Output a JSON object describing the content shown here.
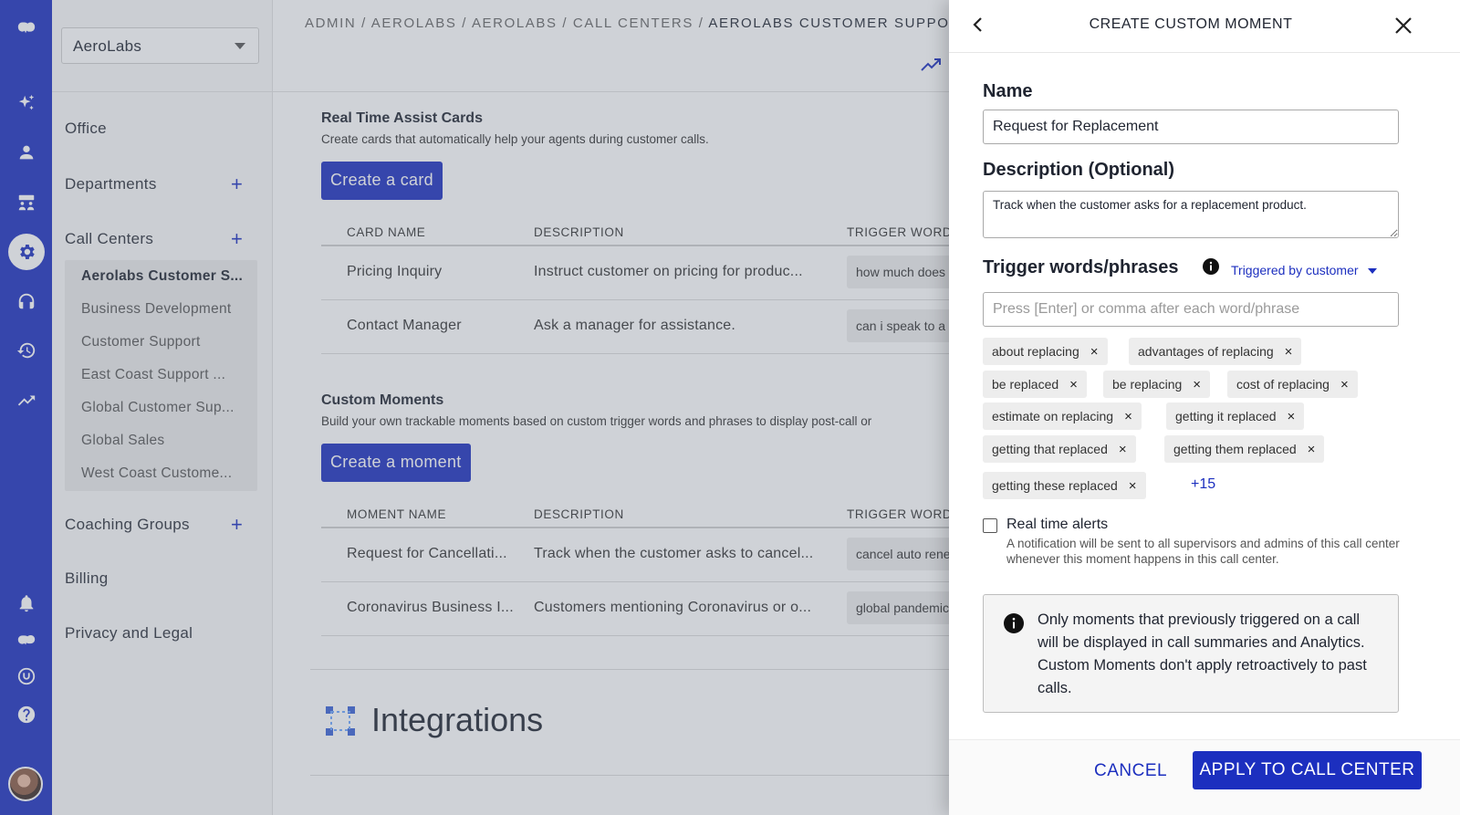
{
  "sidebar": {
    "icons": [
      "dialpad-logo-icon",
      "sparkle-icon",
      "user-icon",
      "contact-center-icon",
      "gear-icon",
      "headset-icon",
      "history-icon",
      "trend-icon",
      "bell-icon",
      "dialpad-icon",
      "chat-icon",
      "help-icon",
      "avatar"
    ],
    "org_select": "AeroLabs",
    "items": {
      "office": "Office",
      "departments": "Departments",
      "call_centers": "Call Centers",
      "coaching_groups": "Coaching Groups",
      "billing": "Billing",
      "privacy": "Privacy and Legal"
    },
    "call_centers": [
      "Aerolabs Customer S...",
      "Business Development",
      "Customer Support",
      "East Coast Support ...",
      "Global Customer Sup...",
      "Global Sales",
      "West Coast Custome..."
    ],
    "plus": "+"
  },
  "breadcrumb": {
    "path": "ADMIN / AEROLABS / AEROLABS / CALL CENTERS / ",
    "current": "AEROLABS CUSTOMER SUPPORT"
  },
  "cards": {
    "title": "Real Time Assist Cards",
    "subtitle": "Create cards that automatically help your agents during customer calls.",
    "button": "Create a card",
    "headers": [
      "CARD NAME",
      "DESCRIPTION",
      "TRIGGER WORDS"
    ],
    "rows": [
      {
        "name": "Pricing Inquiry",
        "desc": "Instruct customer on pricing for produc...",
        "trigger": "how much does"
      },
      {
        "name": "Contact Manager",
        "desc": "Ask a manager for assistance.",
        "trigger": "can i speak to a"
      }
    ]
  },
  "moments": {
    "title": "Custom Moments",
    "subtitle": "Build your own trackable moments based on custom trigger words and phrases to display post-call or",
    "button": "Create a moment",
    "headers": [
      "MOMENT NAME",
      "DESCRIPTION",
      "TRIGGER WORDS"
    ],
    "rows": [
      {
        "name": "Request for Cancellati...",
        "desc": "Track when the customer asks to cancel...",
        "trigger": "cancel auto rene"
      },
      {
        "name": "Coronavirus Business I...",
        "desc": "Customers mentioning Coronavirus or o...",
        "trigger": "global pandemic"
      }
    ]
  },
  "integrations": {
    "title": "Integrations"
  },
  "drawer": {
    "title": "CREATE CUSTOM MOMENT",
    "name_label": "Name",
    "name_value": "Request for Replacement",
    "desc_label": "Description (Optional)",
    "desc_value": "Track when the customer asks for a replacement product.",
    "trigger_label": "Trigger words/phrases",
    "triggered_by": "Triggered by customer",
    "trigger_placeholder": "Press [Enter] or comma after each word/phrase",
    "tags": [
      "about replacing",
      "advantages of replacing",
      "be replaced",
      "be replacing",
      "cost of replacing",
      "estimate on replacing",
      "getting it replaced",
      "getting that replaced",
      "getting them replaced",
      "getting these replaced"
    ],
    "tag_remove": "×",
    "more_count": "+15",
    "alerts_label": "Real time alerts",
    "alerts_desc": "A notification will be sent to all supervisors and admins of this call center whenever this moment happens in this call center.",
    "note": "Only moments that previously triggered on a call will be displayed in call summaries and Analytics. Custom Moments don't apply retroactively to past calls.",
    "cancel": "CANCEL",
    "apply": "APPLY TO CALL CENTER"
  }
}
